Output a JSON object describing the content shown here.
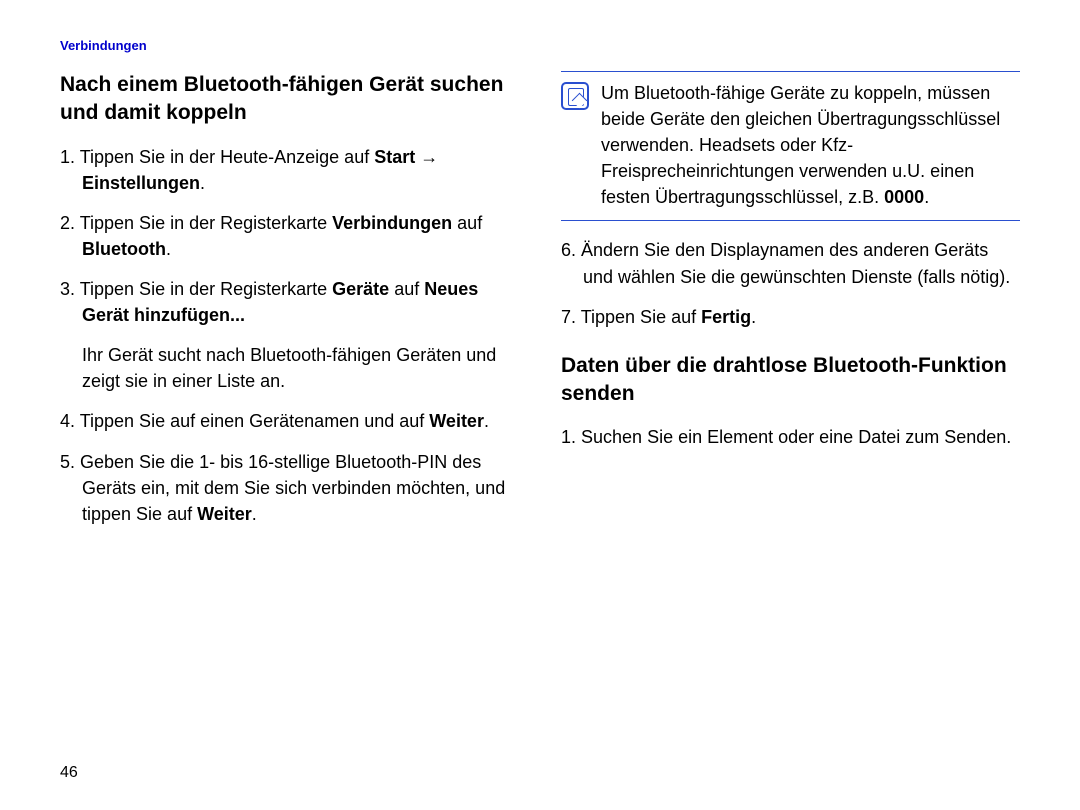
{
  "header": "Verbindungen",
  "pageNumber": "46",
  "left": {
    "heading": "Nach einem Bluetooth-fähigen Gerät suchen und damit koppeln",
    "s1_a": "1. Tippen Sie in der Heute-Anzeige auf ",
    "s1_b": "Start",
    "s1_arrow": " → ",
    "s1_c": "Einstellungen",
    "s1_d": ".",
    "s2_a": "2. Tippen Sie in der Registerkarte ",
    "s2_b": "Verbindungen",
    "s2_c": " auf ",
    "s2_d": "Bluetooth",
    "s2_e": ".",
    "s3_a": "3. Tippen Sie in der Registerkarte ",
    "s3_b": "Geräte",
    "s3_c": " auf ",
    "s3_d": "Neues Gerät hinzufügen...",
    "s3_sub": "Ihr Gerät sucht nach Bluetooth-fähigen Geräten und zeigt sie in einer Liste an.",
    "s4_a": "4. Tippen Sie auf einen Gerätenamen und auf ",
    "s4_b": "Weiter",
    "s4_c": ".",
    "s5_a": "5. Geben Sie die 1- bis 16-stellige Bluetooth-PIN des Geräts ein, mit dem Sie sich verbinden möchten, und tippen Sie auf ",
    "s5_b": "Weiter",
    "s5_c": "."
  },
  "right": {
    "note_a": "Um Bluetooth-fähige Geräte zu koppeln, müssen beide Geräte den gleichen Übertragungsschlüssel verwenden. Headsets oder Kfz-Freisprecheinrichtungen verwenden u.U. einen festen Übertragungsschlüssel, z.B. ",
    "note_b": "0000",
    "note_c": ".",
    "s6": "6. Ändern Sie den Displaynamen des anderen Geräts und wählen Sie die gewünschten Dienste (falls nötig).",
    "s7_a": "7. Tippen Sie auf ",
    "s7_b": "Fertig",
    "s7_c": ".",
    "heading2": "Daten über die drahtlose Bluetooth-Funktion senden",
    "h2_s1": "1. Suchen Sie ein Element oder eine Datei zum Senden."
  }
}
